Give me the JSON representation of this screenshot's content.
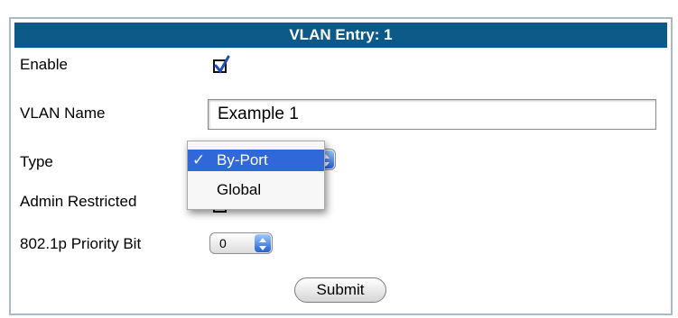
{
  "form": {
    "title": "VLAN Entry: 1",
    "enable": {
      "label": "Enable",
      "checked": true
    },
    "vlan_name": {
      "label": "VLAN Name",
      "value": "Example 1"
    },
    "type": {
      "label": "Type",
      "options": [
        {
          "label": "By-Port",
          "selected": true,
          "check": "✓"
        },
        {
          "label": "Global",
          "selected": false
        }
      ]
    },
    "admin_restricted": {
      "label": "Admin Restricted"
    },
    "priority_bit": {
      "label": "802.1p Priority Bit",
      "value": "0"
    },
    "submit_label": "Submit"
  },
  "colors": {
    "header_bg": "#0d5a89",
    "header_text": "#ffffff",
    "selected_option_bg": "#3068d9",
    "checkbox_check": "#1f4fb0"
  }
}
